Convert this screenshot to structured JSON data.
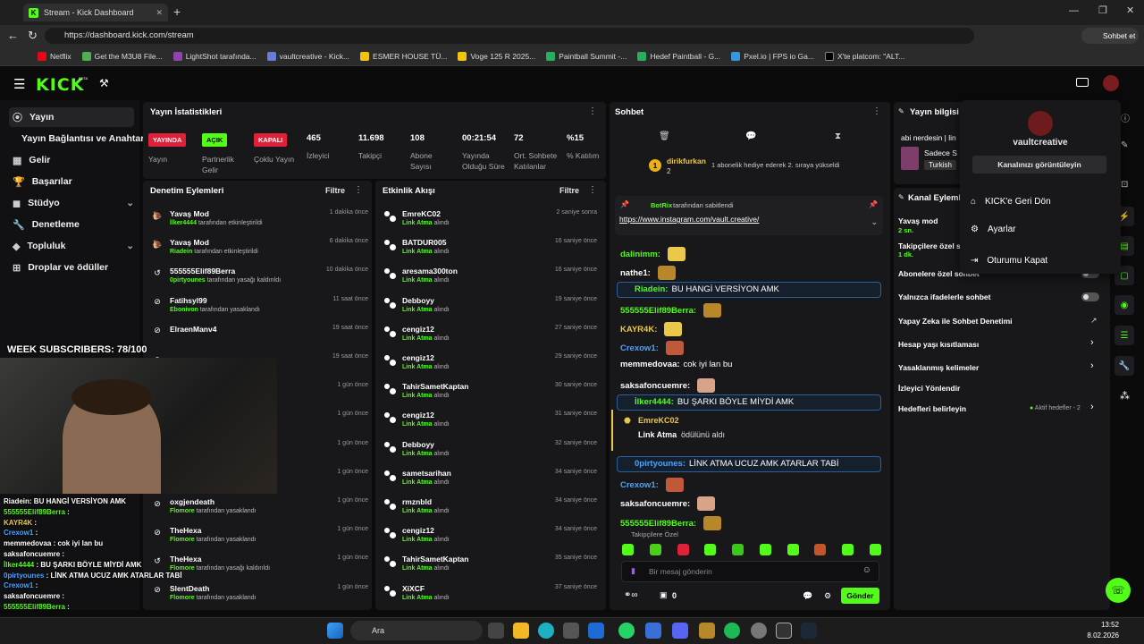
{
  "browser": {
    "tab_title": "Stream - Kick Dashboard",
    "url": "https://dashboard.kick.com/stream",
    "profile_label": "Sohbet et",
    "bookmarks": [
      "Netflix",
      "Get the M3U8 File...",
      "LightShot tarafında...",
      "vaultcreative - Kick...",
      "ESMER HOUSE TÜ...",
      "Voge 125 R 2025...",
      "Paintball Summit -...",
      "Hedef Paintball - G...",
      "Pxel.io | FPS io Ga...",
      "X'te platcom: \"ALT..."
    ]
  },
  "app": {
    "logo": "KICK",
    "beta": "BETA"
  },
  "sidebar": {
    "items": [
      "Yayın",
      "Yayın Bağlantısı ve Anahtarı",
      "Gelir",
      "Başarılar",
      "Stüdyo",
      "Denetleme",
      "Topluluk",
      "Droplar ve ödüller"
    ]
  },
  "stats": {
    "title": "Yayın İstatistikleri",
    "tags": [
      "YAYINDA",
      "AÇIK",
      "KAPALI"
    ],
    "tag_labels": [
      "Yayın",
      "Partnerlik Gelir",
      "Çoklu Yayın"
    ],
    "values": [
      "465",
      "11.698",
      "108",
      "00:21:54",
      "72",
      "%15"
    ],
    "labels": [
      "İzleyici",
      "Takipçi",
      "Abone Sayısı",
      "Yayında Olduğu Süre",
      "Ort. Sohbete Katılanlar",
      "% Katılım"
    ]
  },
  "mod": {
    "title": "Denetim Eylemleri",
    "filter": "Filtre",
    "rows": [
      {
        "name": "Yavaş Mod",
        "user": "İlker4444",
        "action": "tarafından etkinleştirildi",
        "time": "1 dakika önce"
      },
      {
        "name": "Yavaş Mod",
        "user": "Riadein",
        "action": "tarafından etkinleştirildi",
        "time": "6 dakika önce"
      },
      {
        "name": "555555Elif89Berra",
        "user": "0pirtyounes",
        "action": "tarafından yasağı kaldırıldı",
        "time": "10 dakika önce"
      },
      {
        "name": "Fatihsyl99",
        "user": "Ebonivon",
        "action": "tarafından yasaklandı",
        "time": "11 saat önce"
      },
      {
        "name": "ElraenManv4",
        "user": "",
        "action": "",
        "time": "19 saat önce"
      },
      {
        "name": "",
        "user": "",
        "action": "",
        "time": "19 saat önce"
      },
      {
        "name": "",
        "user": "",
        "action": "",
        "time": "1 gün önce"
      },
      {
        "name": "",
        "user": "",
        "action": "",
        "time": "1 gün önce"
      },
      {
        "name": "",
        "user": "",
        "action": "",
        "time": "1 gün önce"
      },
      {
        "name": "",
        "user": "",
        "action": "",
        "time": "1 gün önce"
      },
      {
        "name": "oxgjendeath",
        "user": "Flomore",
        "action": "tarafından yasaklandı",
        "time": "1 gün önce"
      },
      {
        "name": "TheHexa",
        "user": "Flomore",
        "action": "tarafından yasaklandı",
        "time": "1 gün önce"
      },
      {
        "name": "TheHexa",
        "user": "Flomore",
        "action": "tarafından yasağı kaldırıldı",
        "time": "1 gün önce"
      },
      {
        "name": "SlentDeath",
        "user": "Flomore",
        "action": "tarafından yasaklandı",
        "time": "1 gün önce"
      }
    ]
  },
  "events": {
    "title": "Etkinlik Akışı",
    "filter": "Filtre",
    "sub_user": "Link Atma",
    "sub_text": "alındı",
    "rows": [
      {
        "name": "EmreKC02",
        "time": "2 saniye sonra"
      },
      {
        "name": "BATDUR005",
        "time": "16 saniye önce"
      },
      {
        "name": "aresama300ton",
        "time": "16 saniye önce"
      },
      {
        "name": "Debboyy",
        "time": "19 saniye önce"
      },
      {
        "name": "cengiz12",
        "time": "27 saniye önce"
      },
      {
        "name": "cengiz12",
        "time": "29 saniye önce"
      },
      {
        "name": "TahirSametKaptan",
        "time": "30 saniye önce"
      },
      {
        "name": "cengiz12",
        "time": "31 saniye önce"
      },
      {
        "name": "Debboyy",
        "time": "32 saniye önce"
      },
      {
        "name": "sametsarihan",
        "time": "34 saniye önce"
      },
      {
        "name": "rmznbld",
        "time": "34 saniye önce"
      },
      {
        "name": "cengiz12",
        "time": "34 saniye önce"
      },
      {
        "name": "TahirSametKaptan",
        "time": "35 saniye önce"
      },
      {
        "name": "XiXCF",
        "time": "37 saniye önce"
      }
    ]
  },
  "chat": {
    "title": "Sohbet",
    "gift_user": "dirikfurkan",
    "gift_count": "2",
    "gift_text": "1 abonelik hediye ederek 2. sıraya yükseldi",
    "pinned_by": "BotRix",
    "pinned_text": "tarafından sabitlendi",
    "pinned_link": "https://www.instagram.com/vault.creative/",
    "messages": [
      {
        "user": "dalinimm:",
        "text": ""
      },
      {
        "user": "nathe1:",
        "text": ""
      },
      {
        "user": "Riadein:",
        "text": "BU HANGİ VERSİYON AMK"
      },
      {
        "user": "555555Elif89Berra:",
        "text": ""
      },
      {
        "user": "KAYR4K:",
        "text": ""
      },
      {
        "user": "Crexow1:",
        "text": ""
      },
      {
        "user": "memmedovaa:",
        "text": "cok iyi lan bu"
      },
      {
        "user": "saksafoncuemre:",
        "text": ""
      },
      {
        "user": "İlker4444:",
        "text": "BU ŞARKI BÖYLE MİYDİ AMK"
      },
      {
        "user": "0pirtyounes:",
        "text": "LİNK ATMA UCUZ AMK ATARLAR TABİ"
      },
      {
        "user": "Crexow1:",
        "text": ""
      },
      {
        "user": "saksafoncuemre:",
        "text": ""
      },
      {
        "user": "555555Elif89Berra:",
        "text": ""
      }
    ],
    "redeem_user": "EmreKC02",
    "redeem_text": "Link Atma",
    "redeem_suffix": "ödülünü aldı",
    "followers_only": "Takipçilere Özel",
    "input_placeholder": "Bir mesaj gönderin",
    "send": "Gönder",
    "points": "0"
  },
  "info": {
    "title": "Yayın bilgisi",
    "stream_title": "abi nerdesin | lin",
    "category": "Sadece S",
    "language": "Turkish"
  },
  "channel": {
    "title": "Kanal Eylemleri",
    "slow_mode": "Yavaş mod",
    "slow_val": "2 sn.",
    "followers": "Takipçilere özel s",
    "followers_val": "1 dk.",
    "items": [
      "Abonelere özel sohbet",
      "Yalnızca ifadelerle sohbet",
      "Yapay Zeka ile Sohbet Denetimi",
      "Hesap yaşı kısıtlaması",
      "Yasaklanmış kelimeler",
      "İzleyici Yönlendir",
      "Hedefleri belirleyin"
    ],
    "goals_status": "Aktif hedefler - 2"
  },
  "menu": {
    "username": "vaultcreative",
    "view_channel": "Kanalınızı görüntüleyin",
    "items": [
      "KICK'e Geri Dön",
      "Ayarlar",
      "Oturumu Kapat"
    ]
  },
  "overlay": {
    "week_subs": "WEEK SUBSCRIBERS: 78/100",
    "chat": [
      {
        "user": "Riadein",
        "text": ": BU HANGİ VERSİYON AMK"
      },
      {
        "user": "555555Elif89Berra",
        "text": " :"
      },
      {
        "user": "KAYR4K",
        "text": " :"
      },
      {
        "user": "Crexow1",
        "text": " :"
      },
      {
        "user": "memmedovaa",
        "text": " : cok iyi lan bu"
      },
      {
        "user": "saksafoncuemre",
        "text": " :"
      },
      {
        "user": "İlker4444",
        "text": " : BU ŞARKI BÖYLE MİYDİ AMK"
      },
      {
        "user": "0pirtyounes",
        "text": " : LİNK ATMA UCUZ AMK ATARLAR TABİ"
      },
      {
        "user": "Crexow1",
        "text": " :"
      },
      {
        "user": "saksafoncuemre",
        "text": " :"
      },
      {
        "user": "555555Elif89Berra",
        "text": " :"
      }
    ]
  },
  "taskbar": {
    "search": "Ara",
    "time": "13:52",
    "date": "8.02.2026"
  }
}
